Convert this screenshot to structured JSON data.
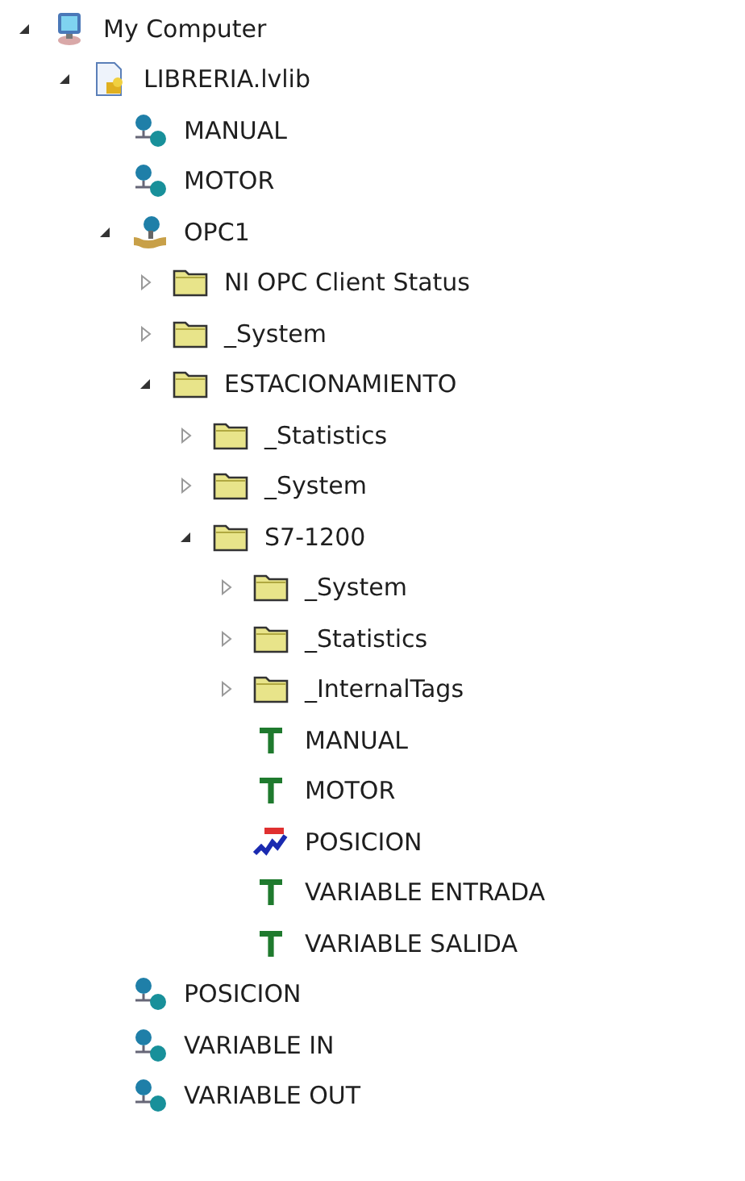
{
  "tree": [
    {
      "label": "My Computer",
      "kind": "computer",
      "expanded": true,
      "children": [
        {
          "label": "LIBRERIA.lvlib",
          "kind": "library",
          "expanded": true,
          "children": [
            {
              "label": "MANUAL",
              "kind": "variable"
            },
            {
              "label": "MOTOR",
              "kind": "variable"
            },
            {
              "label": "OPC1",
              "kind": "server",
              "expanded": true,
              "children": [
                {
                  "label": "NI OPC Client Status",
                  "kind": "folder",
                  "expanded": false
                },
                {
                  "label": "_System",
                  "kind": "folder",
                  "expanded": false
                },
                {
                  "label": "ESTACIONAMIENTO",
                  "kind": "folder",
                  "expanded": true,
                  "children": [
                    {
                      "label": "_Statistics",
                      "kind": "folder",
                      "expanded": false
                    },
                    {
                      "label": "_System",
                      "kind": "folder",
                      "expanded": false
                    },
                    {
                      "label": "S7-1200",
                      "kind": "folder",
                      "expanded": true,
                      "children": [
                        {
                          "label": "_System",
                          "kind": "folder",
                          "expanded": false
                        },
                        {
                          "label": "_Statistics",
                          "kind": "folder",
                          "expanded": false
                        },
                        {
                          "label": "_InternalTags",
                          "kind": "folder",
                          "expanded": false
                        },
                        {
                          "label": "MANUAL",
                          "kind": "tag"
                        },
                        {
                          "label": "MOTOR",
                          "kind": "tag"
                        },
                        {
                          "label": "POSICION",
                          "kind": "waveform"
                        },
                        {
                          "label": "VARIABLE ENTRADA",
                          "kind": "tag"
                        },
                        {
                          "label": "VARIABLE SALIDA",
                          "kind": "tag"
                        }
                      ]
                    }
                  ]
                }
              ]
            },
            {
              "label": "POSICION",
              "kind": "variable"
            },
            {
              "label": "VARIABLE IN",
              "kind": "variable"
            },
            {
              "label": "VARIABLE OUT",
              "kind": "variable"
            }
          ]
        }
      ]
    }
  ]
}
